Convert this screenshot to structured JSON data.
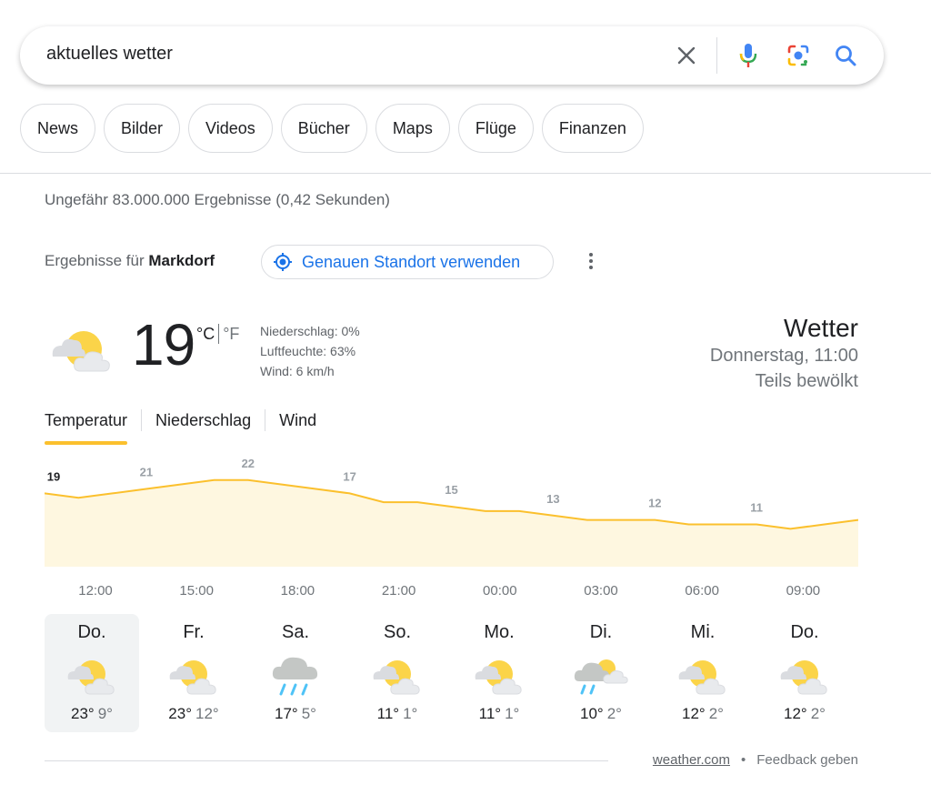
{
  "search": {
    "query": "aktuelles wetter"
  },
  "chips": [
    "News",
    "Bilder",
    "Videos",
    "Bücher",
    "Maps",
    "Flüge",
    "Finanzen"
  ],
  "results_stats": "Ungefähr 83.000.000 Ergebnisse (0,42 Sekunden)",
  "location": {
    "prefix": "Ergebnisse für",
    "place": "Markdorf",
    "use_location_label": "Genauen Standort verwenden"
  },
  "current": {
    "temperature": "19",
    "unit_c": "°C",
    "unit_f": "°F",
    "precipitation": "Niederschlag: 0%",
    "humidity": "Luftfeuchte: 63%",
    "wind": "Wind: 6 km/h",
    "icon": "partly-cloudy-icon"
  },
  "header": {
    "title": "Wetter",
    "datetime": "Donnerstag, 11:00",
    "condition": "Teils bewölkt"
  },
  "tabs": [
    "Temperatur",
    "Niederschlag",
    "Wind"
  ],
  "chart_data": {
    "type": "area",
    "x": [
      "11:00",
      "12:00",
      "13:00",
      "14:00",
      "15:00",
      "16:00",
      "17:00",
      "18:00",
      "19:00",
      "20:00",
      "21:00",
      "22:00",
      "23:00",
      "00:00",
      "01:00",
      "02:00",
      "03:00",
      "04:00",
      "05:00",
      "06:00",
      "07:00",
      "08:00",
      "09:00",
      "10:00",
      "11:00"
    ],
    "values": [
      19,
      18,
      19,
      20,
      21,
      22,
      22,
      21,
      20,
      19,
      17,
      17,
      16,
      15,
      15,
      14,
      13,
      13,
      13,
      12,
      12,
      12,
      11,
      12,
      13
    ],
    "labels": [
      "19",
      "21",
      "22",
      "17",
      "15",
      "13",
      "12",
      "11"
    ],
    "label_indices": [
      0,
      3,
      6,
      9,
      12,
      15,
      18,
      21
    ],
    "tick_labels": [
      "12:00",
      "15:00",
      "18:00",
      "21:00",
      "00:00",
      "03:00",
      "06:00",
      "09:00"
    ],
    "line_color": "#fbc02d",
    "fill_color": "#fef7e0"
  },
  "forecast": [
    {
      "day": "Do.",
      "hi": "23°",
      "lo": "9°",
      "icon": "partly-cloudy-icon",
      "selected": true
    },
    {
      "day": "Fr.",
      "hi": "23°",
      "lo": "12°",
      "icon": "partly-cloudy-icon",
      "selected": false
    },
    {
      "day": "Sa.",
      "hi": "17°",
      "lo": "5°",
      "icon": "rain-icon",
      "selected": false
    },
    {
      "day": "So.",
      "hi": "11°",
      "lo": "1°",
      "icon": "partly-cloudy-icon",
      "selected": false
    },
    {
      "day": "Mo.",
      "hi": "11°",
      "lo": "1°",
      "icon": "partly-cloudy-icon",
      "selected": false
    },
    {
      "day": "Di.",
      "hi": "10°",
      "lo": "2°",
      "icon": "showers-icon",
      "selected": false
    },
    {
      "day": "Mi.",
      "hi": "12°",
      "lo": "2°",
      "icon": "partly-cloudy-icon",
      "selected": false
    },
    {
      "day": "Do.",
      "hi": "12°",
      "lo": "2°",
      "icon": "partly-cloudy-icon",
      "selected": false
    }
  ],
  "footer": {
    "source": "weather.com",
    "separator": "•",
    "feedback": "Feedback geben"
  },
  "colors": {
    "accent_blue": "#1a73e8",
    "sun": "#fbd449",
    "cloud": "#dadce0"
  }
}
